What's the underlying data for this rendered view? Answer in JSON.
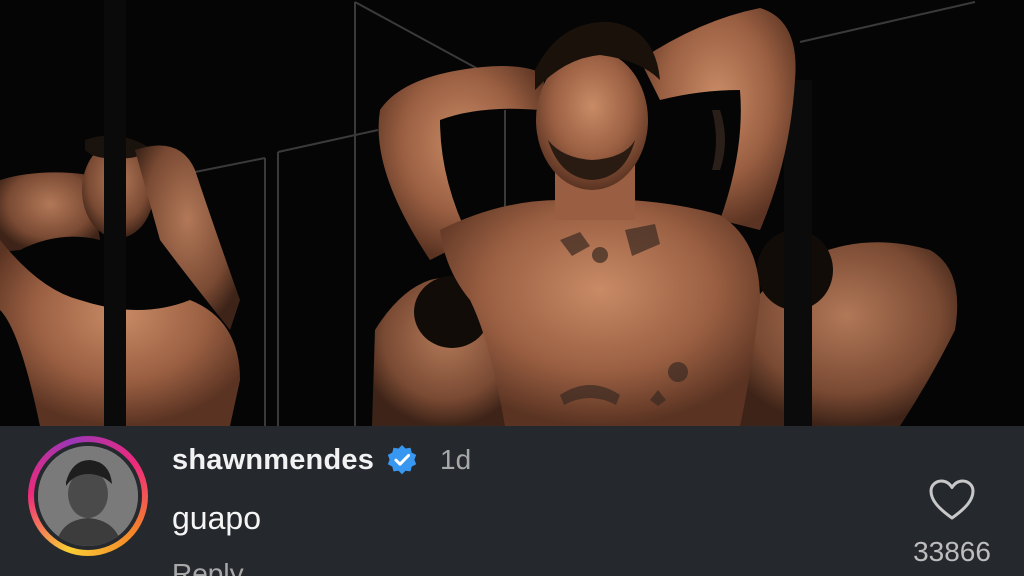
{
  "comment": {
    "username": "shawnmendes",
    "verified_icon": "verified-badge-icon",
    "time": "1d",
    "text": "guapo",
    "reply_label": "Reply",
    "like_icon": "heart-icon",
    "like_count": "33866"
  },
  "colors": {
    "comment_background": "#25292e",
    "verified_blue": "#3897f0",
    "muted_text": "#a8a8a8",
    "primary_text": "#f2f2f2"
  }
}
